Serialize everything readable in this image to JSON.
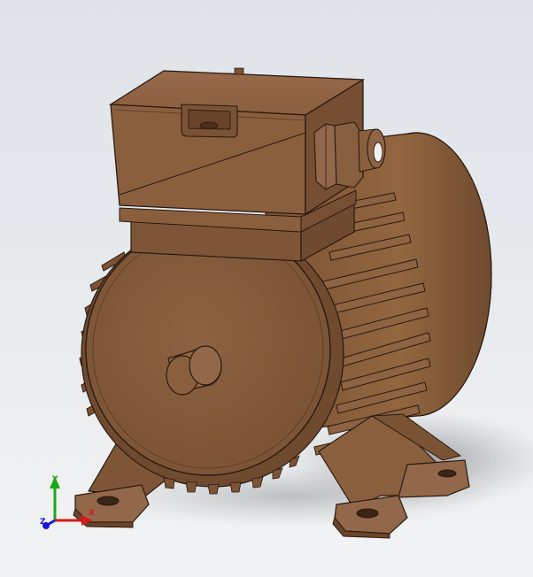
{
  "viewport": {
    "background_top": "#dfe3e8",
    "background_bottom": "#f2f3f4"
  },
  "model": {
    "body_color": "#8a5f3e",
    "edge_color": "#2a1a10",
    "highlight_color": "#a77a57",
    "shadow_color": "#5a3b24"
  },
  "triad": {
    "y_label": "Y",
    "x_label": "X",
    "z_label": "Z",
    "y_color": "#1aa81a",
    "x_color": "#d41a1a",
    "z_color": "#1a1ad4"
  }
}
